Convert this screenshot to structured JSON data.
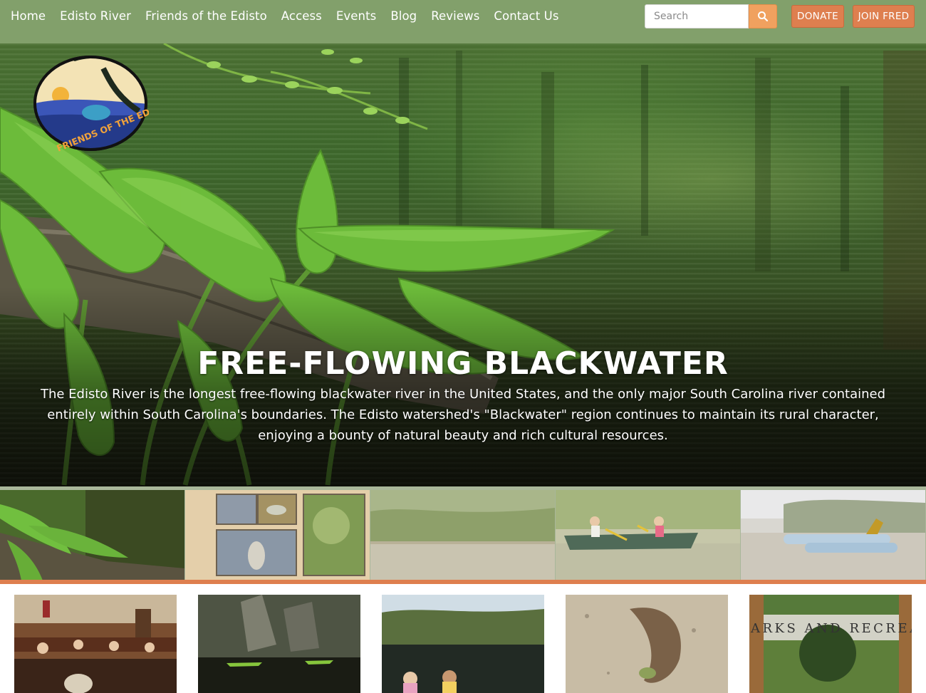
{
  "nav": {
    "items": [
      {
        "label": "Home"
      },
      {
        "label": "Edisto River"
      },
      {
        "label": "Friends of the Edisto"
      },
      {
        "label": "Access"
      },
      {
        "label": "Events"
      },
      {
        "label": "Blog"
      },
      {
        "label": "Reviews"
      },
      {
        "label": "Contact Us"
      }
    ],
    "search_placeholder": "Search",
    "donate_label": "DONATE",
    "join_label": "JOIN FRED"
  },
  "logo": {
    "text": "FRIENDS OF THE EDISTO"
  },
  "hero": {
    "title": "FREE-FLOWING BLACKWATER",
    "text": "The Edisto River is the longest free-flowing blackwater river in the United States, and the only major South Carolina river contained entirely within South Carolina's boundaries.  The Edisto watershed's \"Blackwater\" region continues to maintain its rural character, enjoying a bounty of natural beauty and rich cultural resources."
  },
  "cards": {
    "parks_banner": "ARKS AND RECREA"
  },
  "colors": {
    "nav_bg": "#82a06b",
    "accent_orange": "#de7f4f",
    "search_btn": "#f0a15f",
    "strip_bg": "#a9b79a"
  },
  "icons": {
    "search_button": "search-icon"
  }
}
